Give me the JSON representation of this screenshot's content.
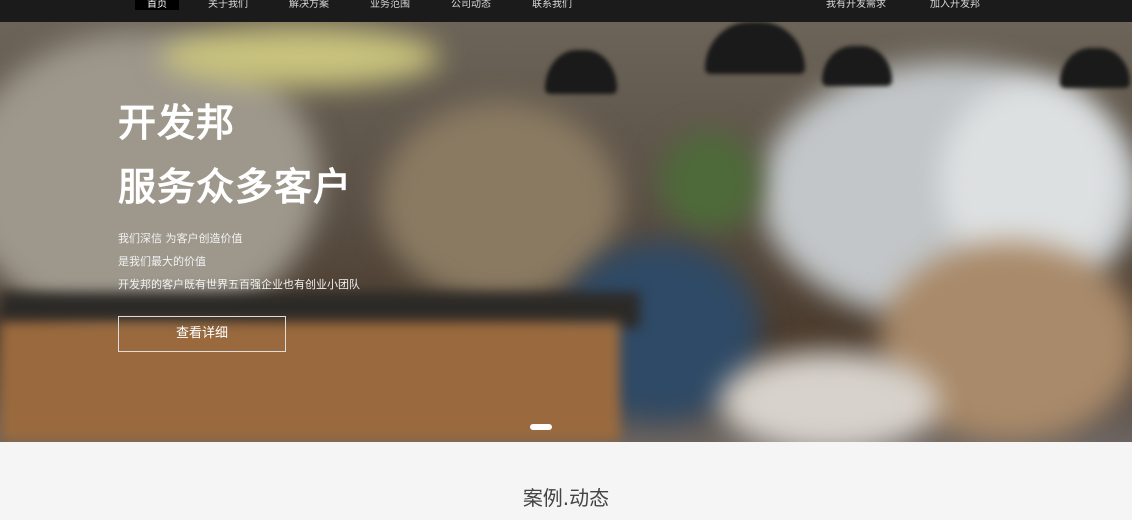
{
  "nav": {
    "items": [
      {
        "label": "首页",
        "active": true
      },
      {
        "label": "关于我们"
      },
      {
        "label": "解决方案"
      },
      {
        "label": "业务范围"
      },
      {
        "label": "公司动态"
      },
      {
        "label": "联系我们"
      }
    ],
    "right_items": [
      {
        "label": "我有开发需求"
      },
      {
        "label": "加入开发邦"
      }
    ]
  },
  "hero": {
    "title_line1": "开发邦",
    "title_line2": "服务众多客户",
    "lines": [
      "我们深信 为客户创造价值",
      "是我们最大的价值",
      "开发邦的客户既有世界五百强企业也有创业小团队"
    ],
    "button_label": "查看详细"
  },
  "section": {
    "title": "案例.动态"
  },
  "colors": {
    "nav_bg": "#1b1b1b",
    "page_bg": "#f5f5f5",
    "accent": "#ffffff"
  }
}
